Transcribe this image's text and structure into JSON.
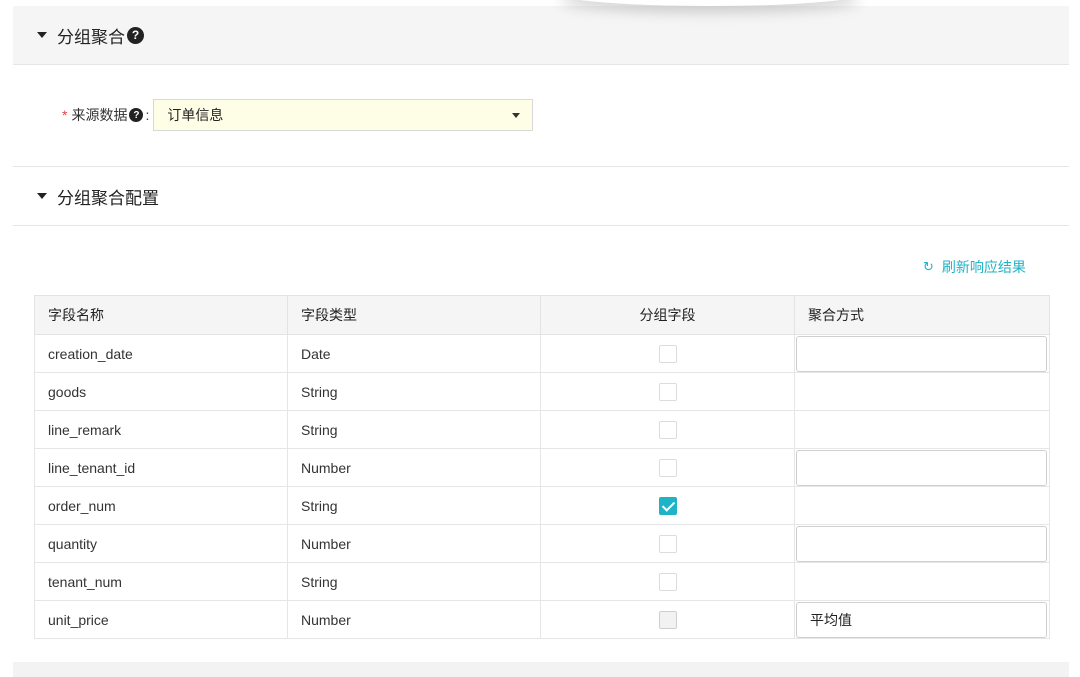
{
  "section1": {
    "title": "分组聚合",
    "help": "?"
  },
  "source": {
    "required": "*",
    "label": "来源数据",
    "help": "?",
    "colon": ":",
    "value": "订单信息"
  },
  "section2": {
    "title": "分组聚合配置"
  },
  "refresh": {
    "icon": "↻",
    "label": "刷新响应结果"
  },
  "table": {
    "headers": [
      "字段名称",
      "字段类型",
      "分组字段",
      "聚合方式"
    ],
    "rows": [
      {
        "name": "creation_date",
        "type": "Date",
        "group": false,
        "agg": ""
      },
      {
        "name": "goods",
        "type": "String",
        "group": false,
        "agg": ""
      },
      {
        "name": "line_remark",
        "type": "String",
        "group": false,
        "agg": ""
      },
      {
        "name": "line_tenant_id",
        "type": "Number",
        "group": false,
        "agg": ""
      },
      {
        "name": "order_num",
        "type": "String",
        "group": true,
        "agg": ""
      },
      {
        "name": "quantity",
        "type": "Number",
        "group": false,
        "agg": ""
      },
      {
        "name": "tenant_num",
        "type": "String",
        "group": false,
        "agg": ""
      },
      {
        "name": "unit_price",
        "type": "Number",
        "group": false,
        "agg": "平均值"
      }
    ]
  },
  "colors": {
    "accent": "#1fb3c8",
    "required": "#e6423d",
    "select_bg": "#fefde6"
  }
}
